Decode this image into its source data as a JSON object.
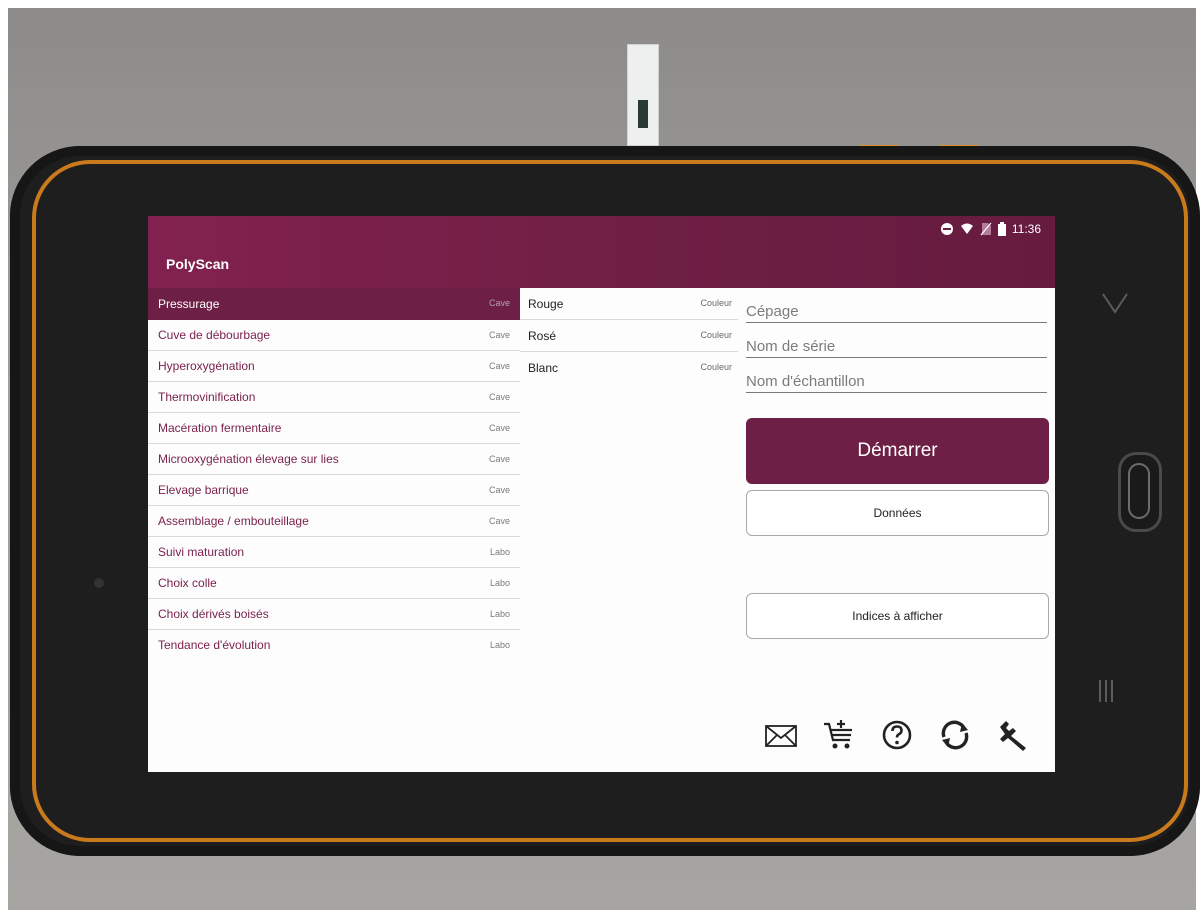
{
  "status_bar": {
    "time": "11:36"
  },
  "app": {
    "title": "PolyScan"
  },
  "process_list": [
    {
      "label": "Pressurage",
      "tag": "Cave"
    },
    {
      "label": "Cuve de débourbage",
      "tag": "Cave"
    },
    {
      "label": "Hyperoxygénation",
      "tag": "Cave"
    },
    {
      "label": "Thermovinification",
      "tag": "Cave"
    },
    {
      "label": "Macération fermentaire",
      "tag": "Cave"
    },
    {
      "label": "Microoxygénation élevage sur lies",
      "tag": "Cave"
    },
    {
      "label": "Elevage barrique",
      "tag": "Cave"
    },
    {
      "label": "Assemblage / embouteillage",
      "tag": "Cave"
    },
    {
      "label": "Suivi maturation",
      "tag": "Labo"
    },
    {
      "label": "Choix colle",
      "tag": "Labo"
    },
    {
      "label": "Choix dérivés boisés",
      "tag": "Labo"
    },
    {
      "label": "Tendance d'évolution",
      "tag": "Labo"
    }
  ],
  "color_list": [
    {
      "label": "Rouge",
      "tag": "Couleur"
    },
    {
      "label": "Rosé",
      "tag": "Couleur"
    },
    {
      "label": "Blanc",
      "tag": "Couleur"
    }
  ],
  "form": {
    "cepage_placeholder": "Cépage",
    "serie_placeholder": "Nom de série",
    "echantillon_placeholder": "Nom d'échantillon",
    "start_label": "Démarrer",
    "data_label": "Données",
    "indices_label": "Indices à afficher"
  },
  "toolbar_icons": [
    "mail-icon",
    "cart-add-icon",
    "help-icon",
    "sync-icon",
    "wrench-icon"
  ],
  "colors": {
    "brand": "#6e1f45",
    "accent_device": "#c87a1c"
  }
}
